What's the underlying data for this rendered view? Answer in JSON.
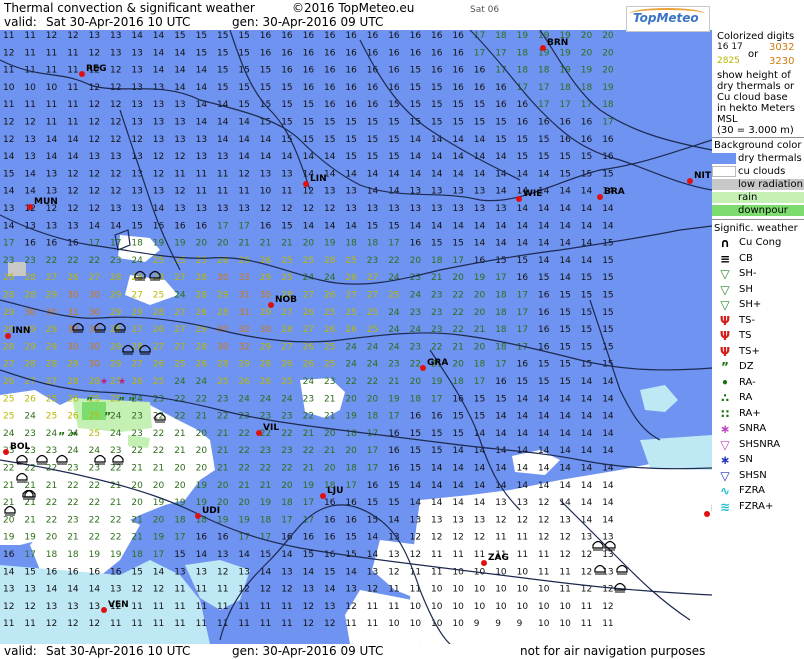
{
  "header": {
    "title": "Thermal convection & significant weather",
    "copyright": "©2016 TopMeteo.eu",
    "satellite": "Sat 06",
    "valid_label": "valid:",
    "valid_value": "Sat  30-Apr-2016   10 UTC",
    "gen_value": "gen: 30-Apr-2016 09 UTC",
    "logo": "TopMeteo"
  },
  "footer": {
    "valid_label": "valid:",
    "valid_value": "Sat  30-Apr-2016   10 UTC",
    "gen_value": "gen: 30-Apr-2016 09 UTC",
    "disclaimer": "not for air navigation purposes"
  },
  "colors": {
    "dry_thermals": "#6f93f0",
    "cu_clouds": "#ffffff",
    "low_radiation": "#c8c8c8",
    "rain": "#c4f0b4",
    "downpour": "#7ddc6e",
    "light_blue": "#bfe8f5",
    "digit_dark": "#111111",
    "digit_green": "#2e6e1a",
    "digit_yellow": "#b8b800",
    "digit_orange": "#d07a10"
  },
  "cities": [
    {
      "code": "BRN"
    },
    {
      "code": "REG"
    },
    {
      "code": "MUN"
    },
    {
      "code": "LIN"
    },
    {
      "code": "WIE"
    },
    {
      "code": "BRA"
    },
    {
      "code": "NIT"
    },
    {
      "code": "INN"
    },
    {
      "code": "NOB"
    },
    {
      "code": "GRA"
    },
    {
      "code": "BOL"
    },
    {
      "code": "VIL"
    },
    {
      "code": "LJU"
    },
    {
      "code": "UDI"
    },
    {
      "code": "ZAG"
    },
    {
      "code": "VEN"
    },
    {
      "code": "B"
    }
  ],
  "legend": {
    "colorized_title": "Colorized digits",
    "ex_1617": "16 17",
    "ex_or": "or",
    "ex_3032": "3032",
    "ex_2825": "2825",
    "ex_3230": "3230",
    "desc_lines": [
      "show height of",
      "dry thermals or",
      "Cu cloud base",
      "in hekto Meters",
      "MSL",
      "(30 = 3.000 m)"
    ],
    "bg_title": "Background color",
    "bg_items": [
      "dry thermals",
      "cu clouds",
      "low radiation",
      "rain",
      "downpour"
    ],
    "wx_title": "Signific. weather",
    "wx_items": [
      "Cu Cong",
      "CB",
      "SH-",
      "SH",
      "SH+",
      "TS-",
      "TS",
      "TS+",
      "DZ",
      "RA-",
      "RA",
      "RA+",
      "SNRA",
      "SHSNRA",
      "SN",
      "SHSN",
      "FZRA",
      "FZRA+"
    ]
  },
  "grid": {
    "rows": [
      "11 11 12 12 13 13 14 14 15 15 15 15 16 16 16 16 16 16 16 16 16 16 17 18 19 19 19 20 20",
      "12 11 11 11 12 13 13 14 14 15 15 15 16 16 16 16 16 16 16 16 16 16 17 17 18 19 19 20 20",
      "11 11 11 11 12 12 13 14 14 14 15 15 15 16 16 16 16 16 16 15 16 16 16 17 18 18 19 19 20",
      "10 10 10 11 12 12 13 13 14 14 15 15 15 15 16 16 16 16 16 15 15 16 16 16 17 17 18 18 19",
      "11 11 11 11 12 12 13 13 13 14 14 15 15 15 15 16 16 16 15 15 15 15 15 16 16 17 17 17 18",
      "12 12 11 11 12 12 13 13 13 14 14 14 15 15 15 15 15 15 15 15 15 15 15 15 16 16 16 16 17",
      "12 13 14 14 12 12 12 13 13 13 14 14 14 15 15 15 15 15 15 14 14 14 14 15 15 15 16 16 16",
      "14 13 14 14 13 13 13 12 12 13 13 14 14 14 14 14 15 15 15 14 14 14 14 14 15 15 15 15 16",
      "15 14 13 12 12 12 13 12 11 11 11 12 13 13 14 14 14 14 14 14 14 14 14 14 14 14 15 15 15",
      "14 14 13 12 12 12 13 13 12 11 11 11 10 11 12 13 13 14 14 13 13 13 13 14 14 14 14 14 14",
      "13 12 12 12 12 13 13 14 13 13 13 13 12 12 12 12 13 13 13 13 13 13 13 13 14 14 14 14 14",
      "14 13 13 13 14 14 15 16 16 16 17 17 16 15 14 14 14 15 15 14 14 14 14 14 14 14 14 14 14",
      "17 16 16 16 17 17 18 19 19 20 20 21 21 21 20 19 18 18 17 16 15 15 14 14 14 14 14 14 15",
      "23 23 22 22 22 23 24 25 25 25 26 26 26 25 25 28 25 23 22 20 18 17 16 15 15 14 14 14 15",
      "26 28 27 26 27 28 29 28 27 28 30 33 29 25 24 24 26 27 24 23 21 20 19 17 16 15 14 15 15",
      "28 28 29 30 30 29 27 25 24 28 29 31 30 28 27 26 27 27 25 24 23 22 20 18 17 16 15 15 15",
      "29 30 30 31 30 29 29 28 27 26 28 31 29 27 26 25 25 25 24 23 23 22 20 18 17 16 15 15 15",
      "29 29 29 30 30 28 27 26 27 29 30 32 30 28 27 26 26 25 24 24 23 22 21 18 17 16 15 15 15",
      "28 29 29 30 30 29 28 27 27 28 30 32 29 27 26 25 24 24 24 23 22 21 20 18 17 16 15 15 15",
      "27 28 28 29 30 29 27 26 25 26 28 29 28 26 26 25 24 24 23 22 21 20 18 17 16 15 15 15 15",
      "26 27 27 28 28 27 26 25 24 24 25 26 26 25 24 23 22 22 21 20 19 18 17 16 15 15 15 14 14",
      "25 26 25 26 25 25 24 23 22 22 23 24 24 24 23 21 20 20 19 18 17 16 15 15 14 14 14 14 14",
      "25 24 25 26 25 24 23 22 22 21 22 23 23 23 22 21 19 18 17 16 16 15 15 14 14 14 14 14 14",
      "24 23 24 24 25 24 23 22 21 20 21 22 22 22 21 20 18 17 16 15 15 15 14 14 14 14 14 14 14",
      "23 23 23 24 24 23 22 22 21 20 21 22 23 23 22 21 20 17 16 15 15 14 14 14 14 14 14 14 14",
      "22 22 22 23 23 22 21 21 20 20 21 22 22 22 21 20 18 17 16 15 14 14 14 14 14 14 14 14 14",
      "21 21 21 22 22 21 20 20 20 19 20 21 21 20 19 18 17 16 15 14 14 14 14 14 14 14 14 14 14",
      "21 21 22 22 22 21 20 19 19 19 20 20 19 18 17 16 16 15 15 14 14 14 14 13 13 12 14 14 14",
      "20 21 22 23 22 22 21 20 18 18 19 19 18 17 17 16 16 15 14 13 13 13 13 12 12 12 13 14 14",
      "19 19 20 21 22 22 21 19 17 16 16 17 17 16 16 16 15 14 13 12 12 12 12 11 11 12 12 13 13",
      "16 17 18 18 19 19 18 17 15 14 13 14 15 14 15 16 15 14 13 12 11 11 11 11 11 11 12 12 13",
      "14 15 16 16 16 16 15 14 13 13 12 13 14 13 14 15 14 13 12 11 11 10 10 10 10 11 11 12 13",
      "13 13 14 14 14 13 12 12 11 11 11 12 12 12 13 14 13 12 11 11 10 10 10 10 10 10 11 12 12",
      "12 12 13 13 13 12 11 11 11 11 11 11 11 11 12 13 12 11 11 10 10 10 10 10 10 10 10 11 12",
      "11 11 12 12 12 11 11 11 11 11 11 11 11 11 12 12 11 11 10 10 10 10 9 9 9 10 10 11 11"
    ]
  }
}
